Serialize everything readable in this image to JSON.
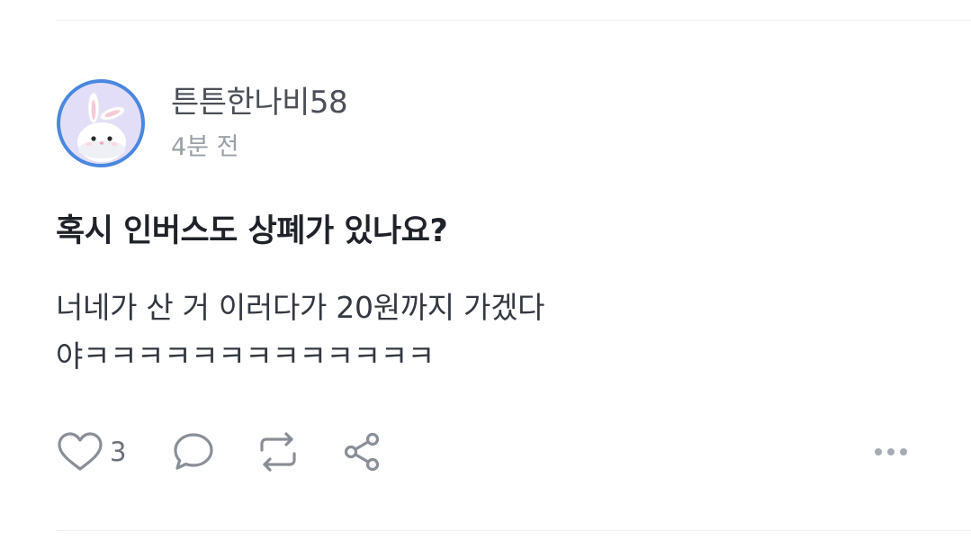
{
  "post": {
    "author": {
      "name": "튼튼한나비58",
      "timestamp": "4분 전",
      "avatar_icon": "rabbit-avatar-icon"
    },
    "title": "혹시 인버스도 상폐가 있나요?",
    "body_lines": [
      "너네가 산 거 이러다가 20원까지 가겠다",
      "야ㅋㅋㅋㅋㅋㅋㅋㅋㅋㅋㅋㅋㅋ"
    ],
    "actions": {
      "like_icon": "heart-icon",
      "like_count": "3",
      "comment_icon": "comment-bubble-icon",
      "repost_icon": "repost-icon",
      "share_icon": "share-icon",
      "more_icon": "more-dots-icon"
    }
  },
  "colors": {
    "avatar_ring": "#4a87e0",
    "avatar_bg": "#e3def7",
    "title": "#1f2329",
    "meta": "#9aa0a8",
    "icon": "#8a8f97"
  }
}
